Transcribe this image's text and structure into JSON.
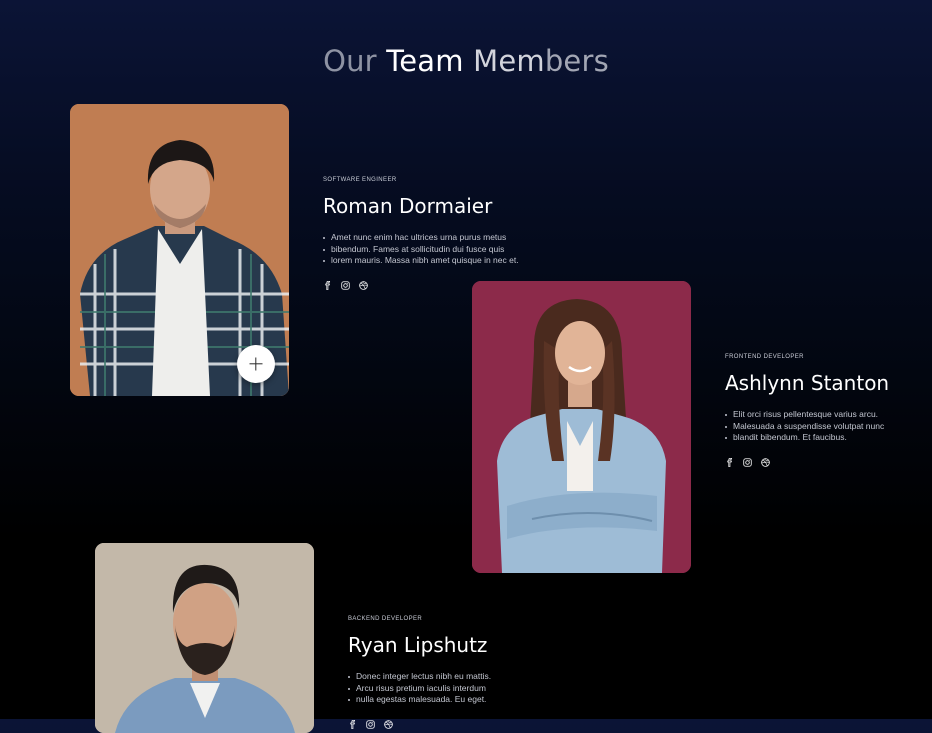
{
  "page": {
    "title_parts": [
      "Our",
      " Team ",
      "Mem",
      "bers"
    ]
  },
  "members": [
    {
      "role": "SOFTWARE ENGINEER",
      "name": "Roman Dormaier",
      "bullets": [
        "Amet nunc enim hac ultrices urna purus metus",
        "bibendum. Fames at sollicitudin dui fusce quis",
        "lorem mauris. Massa nibh amet quisque in nec et."
      ],
      "photo_bg": "#c07d52",
      "socials": [
        "facebook-icon",
        "instagram-icon",
        "dribbble-icon"
      ]
    },
    {
      "role": "FRONTEND DEVELOPER",
      "name": "Ashlynn Stanton",
      "bullets": [
        "Elit orci risus pellentesque varius arcu.",
        "Malesuada a suspendisse volutpat nunc",
        "blandit bibendum. Et faucibus."
      ],
      "photo_bg": "#8c2a4a",
      "socials": [
        "facebook-icon",
        "instagram-icon",
        "dribbble-icon"
      ]
    },
    {
      "role": "BACKEND DEVELOPER",
      "name": "Ryan Lipshutz",
      "bullets": [
        "Donec integer lectus nibh eu mattis.",
        "Arcu risus pretium iaculis interdum",
        "nulla egestas malesuada. Eu eget."
      ],
      "photo_bg": "#c3b8a9",
      "socials": [
        "facebook-icon",
        "instagram-icon",
        "dribbble-icon"
      ]
    }
  ],
  "colors": {
    "background_top": "#0b1436",
    "background_bottom": "#000000",
    "text_primary": "#ffffff",
    "text_muted": "#c4c7d1"
  }
}
